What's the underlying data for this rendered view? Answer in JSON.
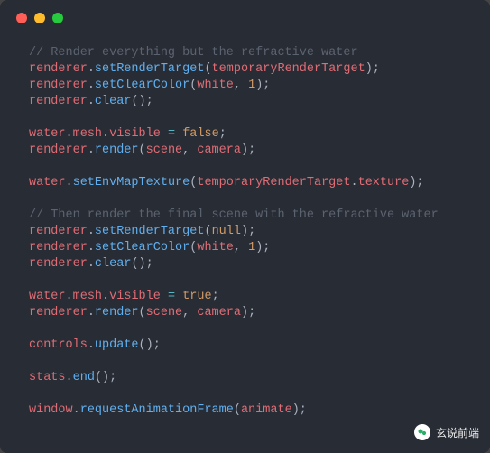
{
  "code": {
    "lines": [
      {
        "type": "comment",
        "text": "// Render everything but the refractive water"
      },
      {
        "type": "call",
        "chain": [
          "renderer"
        ],
        "method": "setRenderTarget",
        "args": [
          {
            "kind": "ident",
            "v": "temporaryRenderTarget"
          }
        ]
      },
      {
        "type": "call",
        "chain": [
          "renderer"
        ],
        "method": "setClearColor",
        "args": [
          {
            "kind": "ident",
            "v": "white"
          },
          {
            "kind": "num",
            "v": "1"
          }
        ]
      },
      {
        "type": "call",
        "chain": [
          "renderer"
        ],
        "method": "clear",
        "args": []
      },
      {
        "type": "blank"
      },
      {
        "type": "assign",
        "chain": [
          "water",
          "mesh",
          "visible"
        ],
        "value": {
          "kind": "const",
          "v": "false"
        }
      },
      {
        "type": "call",
        "chain": [
          "renderer"
        ],
        "method": "render",
        "args": [
          {
            "kind": "ident",
            "v": "scene"
          },
          {
            "kind": "ident",
            "v": "camera"
          }
        ]
      },
      {
        "type": "blank"
      },
      {
        "type": "call",
        "chain": [
          "water"
        ],
        "method": "setEnvMapTexture",
        "args": [
          {
            "kind": "prop",
            "obj": "temporaryRenderTarget",
            "prop": "texture"
          }
        ]
      },
      {
        "type": "blank"
      },
      {
        "type": "comment",
        "text": "// Then render the final scene with the refractive water"
      },
      {
        "type": "call",
        "chain": [
          "renderer"
        ],
        "method": "setRenderTarget",
        "args": [
          {
            "kind": "const",
            "v": "null"
          }
        ]
      },
      {
        "type": "call",
        "chain": [
          "renderer"
        ],
        "method": "setClearColor",
        "args": [
          {
            "kind": "ident",
            "v": "white"
          },
          {
            "kind": "num",
            "v": "1"
          }
        ]
      },
      {
        "type": "call",
        "chain": [
          "renderer"
        ],
        "method": "clear",
        "args": []
      },
      {
        "type": "blank"
      },
      {
        "type": "assign",
        "chain": [
          "water",
          "mesh",
          "visible"
        ],
        "value": {
          "kind": "const",
          "v": "true"
        }
      },
      {
        "type": "call",
        "chain": [
          "renderer"
        ],
        "method": "render",
        "args": [
          {
            "kind": "ident",
            "v": "scene"
          },
          {
            "kind": "ident",
            "v": "camera"
          }
        ]
      },
      {
        "type": "blank"
      },
      {
        "type": "call",
        "chain": [
          "controls"
        ],
        "method": "update",
        "args": []
      },
      {
        "type": "blank"
      },
      {
        "type": "call",
        "chain": [
          "stats"
        ],
        "method": "end",
        "args": []
      },
      {
        "type": "blank"
      },
      {
        "type": "call",
        "chain": [
          "window"
        ],
        "method": "requestAnimationFrame",
        "args": [
          {
            "kind": "ident",
            "v": "animate"
          }
        ]
      }
    ]
  },
  "watermark": {
    "text": "玄说前端"
  }
}
